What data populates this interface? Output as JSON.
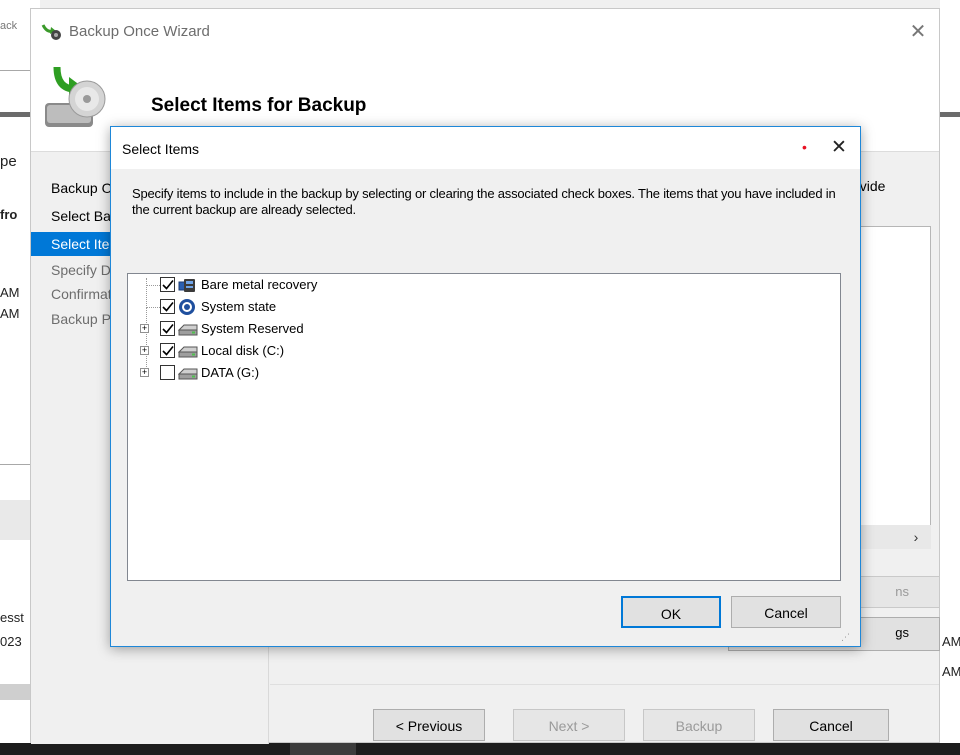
{
  "background": {
    "left_fragments": [
      "ack",
      "pe",
      "fro",
      "AM",
      "AM",
      "esst",
      "023"
    ],
    "right_fragments": [
      "AM",
      "AM"
    ]
  },
  "wizard": {
    "title": "Backup Once Wizard",
    "close_glyph": "✕",
    "heading": "Select Items for Backup",
    "nav": [
      {
        "label": "Backup Options",
        "state": "normal"
      },
      {
        "label": "Select Backup Configuration",
        "state": "normal"
      },
      {
        "label": "Select Items for Backup",
        "state": "active"
      },
      {
        "label": "Specify Destination Type",
        "state": "disabled"
      },
      {
        "label": "Confirmation",
        "state": "disabled"
      },
      {
        "label": "Backup Progress",
        "state": "disabled"
      }
    ],
    "main_text_fragment": "ovide",
    "scroll_right_glyph": "›",
    "ghost_button_1": "ns",
    "ghost_button_2": "gs",
    "buttons": {
      "previous": "< Previous",
      "next": "Next >",
      "backup": "Backup",
      "cancel": "Cancel"
    }
  },
  "dialog": {
    "title": "Select Items",
    "close_glyph": "✕",
    "dot": "•",
    "instructions": "Specify items to include in the backup by selecting or clearing the associated check boxes. The items that you have included in the current backup are already selected.",
    "items": [
      {
        "label": "Bare metal recovery",
        "checked": true,
        "expandable": false,
        "icon": "bare-metal-icon"
      },
      {
        "label": "System state",
        "checked": true,
        "expandable": false,
        "icon": "system-state-icon"
      },
      {
        "label": "System Reserved",
        "checked": true,
        "expandable": true,
        "icon": "drive-icon"
      },
      {
        "label": "Local disk (C:)",
        "checked": true,
        "expandable": true,
        "icon": "drive-icon"
      },
      {
        "label": "DATA (G:)",
        "checked": false,
        "expandable": true,
        "icon": "drive-icon"
      }
    ],
    "expand_glyph": "+",
    "ok_label": "OK",
    "cancel_label": "Cancel",
    "grip_glyph": "⋰"
  }
}
